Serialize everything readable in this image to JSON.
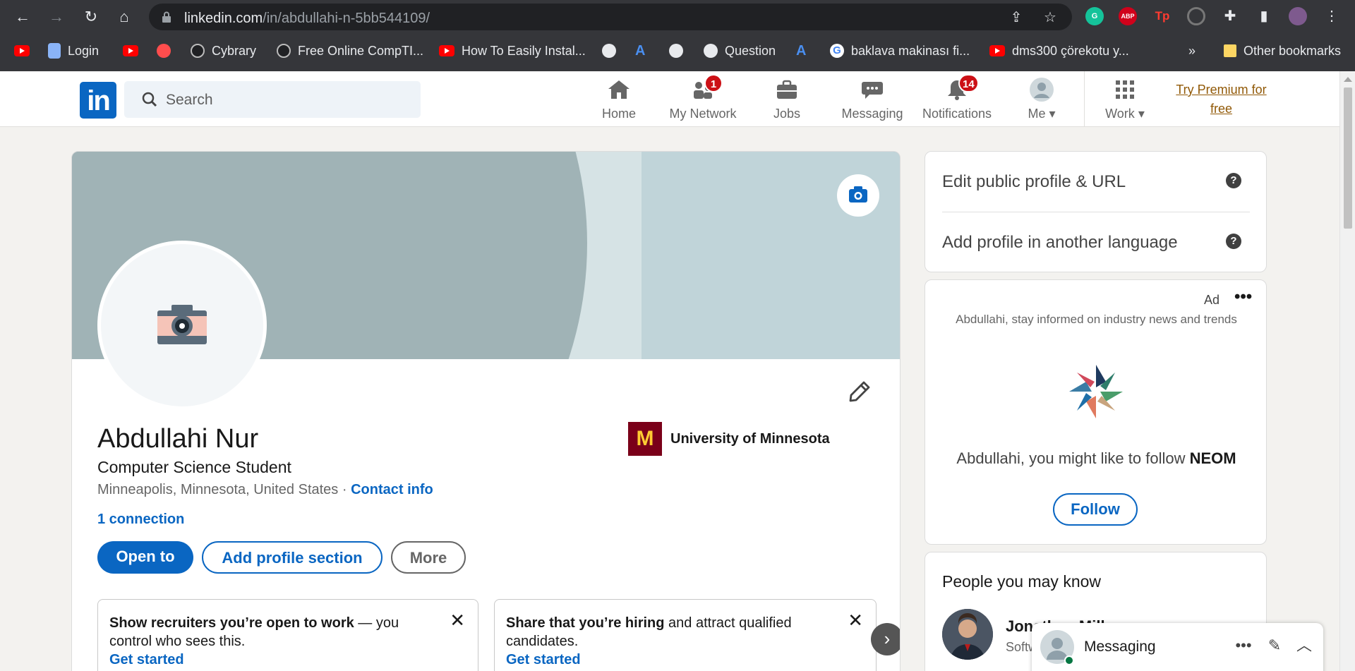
{
  "browser": {
    "url_domain": "linkedin.com",
    "url_path": "/in/abdullahi-n-5bb544109/",
    "extensions": [
      "G",
      "ABP",
      "Tp"
    ],
    "bookmarks": [
      {
        "label": "",
        "icon": "youtube-icon"
      },
      {
        "label": "Login",
        "icon": "page-icon"
      },
      {
        "label": "",
        "icon": "youtube-icon"
      },
      {
        "label": "",
        "icon": "site-icon"
      },
      {
        "label": "Cybrary",
        "icon": "site-icon"
      },
      {
        "label": "Free Online CompTI...",
        "icon": "site-icon"
      },
      {
        "label": "How To Easily Instal...",
        "icon": "youtube-icon"
      },
      {
        "label": "",
        "icon": "globe-icon"
      },
      {
        "label": "",
        "icon": "site-icon"
      },
      {
        "label": "",
        "icon": "globe-icon"
      },
      {
        "label": "Question",
        "icon": "globe-icon"
      },
      {
        "label": "",
        "icon": "site-icon"
      },
      {
        "label": "baklava makinası fi...",
        "icon": "google-icon"
      },
      {
        "label": "dms300 çörekotu y...",
        "icon": "youtube-icon"
      }
    ],
    "bookmarks_overflow": "»",
    "other_bookmarks": "Other bookmarks"
  },
  "nav": {
    "search_placeholder": "Search",
    "items": [
      {
        "label": "Home",
        "badge": ""
      },
      {
        "label": "My Network",
        "badge": "1"
      },
      {
        "label": "Jobs",
        "badge": ""
      },
      {
        "label": "Messaging",
        "badge": ""
      },
      {
        "label": "Notifications",
        "badge": "14"
      },
      {
        "label": "Me",
        "badge": ""
      },
      {
        "label": "Work",
        "badge": ""
      }
    ],
    "premium_line1": "Try Premium for",
    "premium_line2": "free"
  },
  "profile": {
    "name": "Abdullahi Nur",
    "headline": "Computer Science Student",
    "location": "Minneapolis, Minnesota, United States",
    "separator": " · ",
    "contact": "Contact info",
    "connections": "1 connection",
    "school": "University of Minnesota",
    "school_logo": "M",
    "buttons": {
      "open": "Open to",
      "add": "Add profile section",
      "more": "More"
    },
    "promos": [
      {
        "bold": "Show recruiters you’re open to work",
        "rest": " — you control who sees this.",
        "cta": "Get started"
      },
      {
        "bold": "Share that you’re hiring",
        "rest": " and attract qualified candidates.",
        "cta": "Get started"
      }
    ],
    "arrow": "›"
  },
  "rail": {
    "edit_public": "Edit public profile & URL",
    "add_language": "Add profile in another language",
    "ad_label": "Ad",
    "ad_dots": "•••",
    "ad_inform": "Abdullahi, stay informed on industry news and trends",
    "follow_text": "Abdullahi, you might like to follow ",
    "follow_company": "NEOM",
    "follow_button": "Follow",
    "pymk_title": "People you may know",
    "pymk_name": "Jonathan Mill",
    "pymk_desc": "Softw"
  },
  "messaging": {
    "label": "Messaging"
  }
}
